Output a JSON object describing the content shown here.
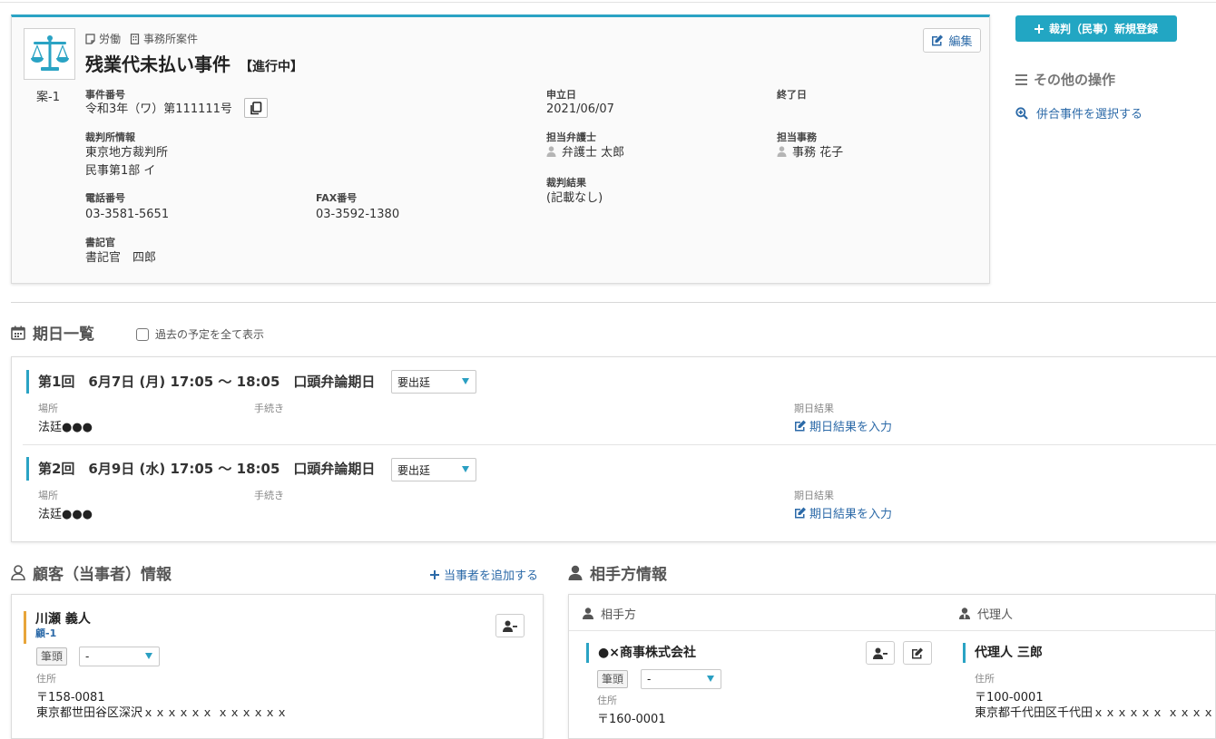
{
  "case": {
    "tags": [
      "労働",
      "事務所案件"
    ],
    "title": "残業代未払い事件",
    "status": "【進行中】",
    "number": "案-1",
    "edit_label": "編集",
    "fields": {
      "case_no_label": "事件番号",
      "case_no": "令和3年（ワ）第111111号",
      "filed_label": "申立日",
      "filed": "2021/06/07",
      "end_label": "終了日",
      "court_label": "裁判所情報",
      "court_line1": "東京地方裁判所",
      "court_line2": "民事第1部 イ",
      "lawyer_label": "担当弁護士",
      "lawyer": "弁護士 太郎",
      "clerk_staff_label": "担当事務",
      "clerk_staff": "事務 花子",
      "result_label": "裁判結果",
      "result": "(記載なし)",
      "phone_label": "電話番号",
      "phone": "03-3581-5651",
      "fax_label": "FAX番号",
      "fax": "03-3592-1380",
      "secretary_label": "書記官",
      "secretary": "書記官　四郎"
    }
  },
  "sidebar": {
    "register_label": "裁判（民事）新規登録",
    "other_ops_label": "その他の操作",
    "merge_label": "併合事件を選択する"
  },
  "schedule": {
    "heading": "期日一覧",
    "past_label": "過去の予定を全て表示",
    "place_label": "場所",
    "procedure_label": "手続き",
    "result_label": "期日結果",
    "result_link": "期日結果を入力",
    "items": [
      {
        "title": "第1回　6月7日 (月) 17:05 ～ 18:05　口頭弁論期日",
        "attendance": "要出廷",
        "place": "法廷●●●"
      },
      {
        "title": "第2回　6月9日 (水) 17:05 ～ 18:05　口頭弁論期日",
        "attendance": "要出廷",
        "place": "法廷●●●"
      }
    ]
  },
  "client": {
    "heading": "顧客（当事者）情報",
    "add_label": "当事者を追加する",
    "name": "川瀬 義人",
    "id": "顧-1",
    "role_badge": "筆頭",
    "role_select": "-",
    "address_label": "住所",
    "postal": "〒158-0081",
    "address": "東京都世田谷区深沢ｘｘｘｘｘｘ ｘｘｘｘｘｘ"
  },
  "opponent": {
    "heading": "相手方情報",
    "col_opponent": "相手方",
    "col_agent": "代理人",
    "name": "●×商事株式会社",
    "role_badge": "筆頭",
    "role_select": "-",
    "address_label": "住所",
    "postal": "〒160-0001",
    "agent_name": "代理人 三郎",
    "agent_address_label": "住所",
    "agent_postal": "〒100-0001",
    "agent_address": "東京都千代田区千代田ｘｘｘｘｘｘ ｘｘｘｘ"
  },
  "colors": {
    "accent": "#22a6c3",
    "link": "#2c6aa8",
    "client_bar": "#e8a53a"
  }
}
